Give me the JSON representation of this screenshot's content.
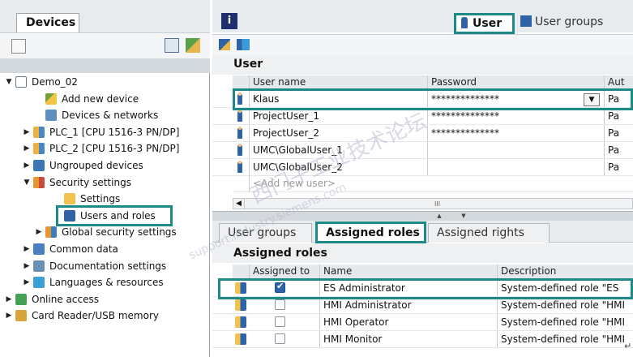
{
  "left_panel": {
    "tab_label": "Devices",
    "tree": [
      {
        "label": "Demo_02",
        "arrow": "▼",
        "icon": "project-icon",
        "indent": 0
      },
      {
        "label": "Add new device",
        "arrow": "",
        "icon": "add-device-icon",
        "indent": 2
      },
      {
        "label": "Devices & networks",
        "arrow": "",
        "icon": "network-icon",
        "indent": 2
      },
      {
        "label": "PLC_1 [CPU 1516-3 PN/DP]",
        "arrow": "▶",
        "icon": "plc-icon",
        "indent": 1
      },
      {
        "label": "PLC_2 [CPU 1516-3 PN/DP]",
        "arrow": "▶",
        "icon": "plc-icon",
        "indent": 1
      },
      {
        "label": "Ungrouped devices",
        "arrow": "▶",
        "icon": "ungrouped-devices-icon",
        "indent": 1
      },
      {
        "label": "Security settings",
        "arrow": "▼",
        "icon": "security-icon",
        "indent": 1
      },
      {
        "label": "Settings",
        "arrow": "",
        "icon": "settings-icon",
        "indent": 3
      },
      {
        "label": "Users and roles",
        "arrow": "",
        "icon": "users-roles-icon",
        "indent": 3
      },
      {
        "label": "Global security settings",
        "arrow": "▶",
        "icon": "global-security-icon",
        "indent": 2
      },
      {
        "label": "Common data",
        "arrow": "▶",
        "icon": "common-data-icon",
        "indent": 1
      },
      {
        "label": "Documentation settings",
        "arrow": "▶",
        "icon": "documentation-icon",
        "indent": 1
      },
      {
        "label": "Languages & resources",
        "arrow": "▶",
        "icon": "languages-icon",
        "indent": 1
      },
      {
        "label": "Online access",
        "arrow": "▶",
        "icon": "online-access-icon",
        "indent": 0
      },
      {
        "label": "Card Reader/USB memory",
        "arrow": "▶",
        "icon": "card-reader-icon",
        "indent": 0
      }
    ]
  },
  "top_tabs": {
    "info_label": "i",
    "user_label": "User",
    "user_groups_label": "User groups"
  },
  "user_section": {
    "title": "User",
    "columns": [
      "User name",
      "Password",
      "Aut"
    ],
    "rows": [
      {
        "name": "Klaus",
        "password": "**************",
        "auth": "Pa"
      },
      {
        "name": "ProjectUser_1",
        "password": "**************",
        "auth": "Pa"
      },
      {
        "name": "ProjectUser_2",
        "password": "**************",
        "auth": "Pa"
      },
      {
        "name": "UMC\\GlobalUser_1",
        "password": "",
        "auth": "Pa"
      },
      {
        "name": "UMC\\GlobalUser_2",
        "password": "",
        "auth": "Pa"
      }
    ],
    "add_new_placeholder": "<Add new user>",
    "scroll_thumb": "III"
  },
  "sub_tabs": [
    "User groups",
    "Assigned roles",
    "Assigned rights"
  ],
  "roles_section": {
    "title": "Assigned roles",
    "columns": [
      "Assigned to",
      "Name",
      "Description"
    ],
    "rows": [
      {
        "assigned": true,
        "name": "ES Administrator",
        "description": "System-defined role \"ES"
      },
      {
        "assigned": false,
        "name": "HMI Administrator",
        "description": "System-defined role \"HMI"
      },
      {
        "assigned": false,
        "name": "HMI Operator",
        "description": "System-defined role \"HMI"
      },
      {
        "assigned": false,
        "name": "HMI Monitor",
        "description": "System-defined role \"HMI"
      }
    ]
  },
  "watermark": {
    "text_1": "西门子工业技术论坛",
    "text_2": "support.industry.siemens.com"
  },
  "corner_mark": "↵",
  "colors": {
    "highlight": "#1d8a87",
    "info_button": "#1e2f6f",
    "user_icon": "#2f63a8"
  }
}
